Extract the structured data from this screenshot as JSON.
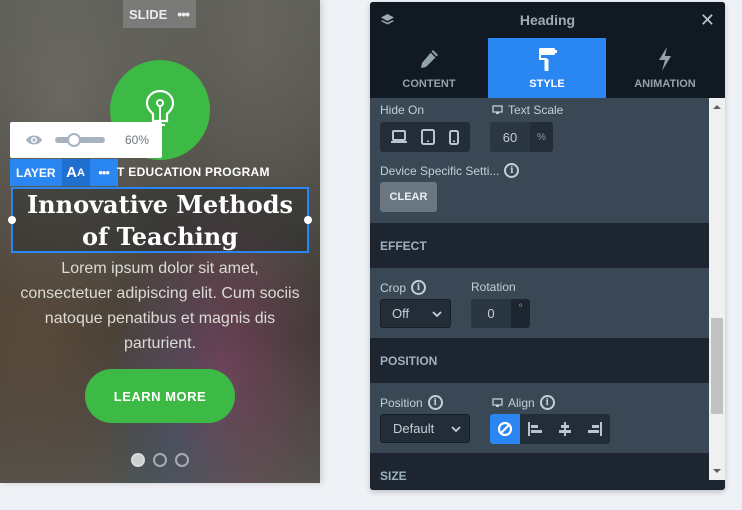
{
  "preview": {
    "slide_tag": "SLIDE",
    "slide_more": "•••",
    "opacity_value": "60%",
    "opacity_fraction": 0.6,
    "layer_label": "LAYER",
    "layer_font_icon_big": "A",
    "layer_font_icon_small": "A",
    "layer_more": "•••",
    "subtitle": "T EDUCATION PROGRAM",
    "heading": "Innovative Methods of Teaching",
    "body": "Lorem ipsum dolor sit amet, consectetuer adipiscing elit. Cum sociis natoque penatibus et magnis dis parturient.",
    "cta": "LEARN MORE",
    "slide_count": 3,
    "active_slide": 1,
    "colors": {
      "accent_green": "#3dba45",
      "selection_blue": "#2a86f0"
    }
  },
  "panel": {
    "title": "Heading",
    "close": "✕",
    "tabs": [
      {
        "label": "CONTENT",
        "icon": "pencil-icon",
        "active": false
      },
      {
        "label": "STYLE",
        "icon": "paint-roller-icon",
        "active": true
      },
      {
        "label": "ANIMATION",
        "icon": "lightning-icon",
        "active": false
      }
    ],
    "hide_on": {
      "label": "Hide On",
      "options": [
        "desktop-icon",
        "tablet-icon",
        "mobile-icon"
      ]
    },
    "text_scale": {
      "label": "Text Scale",
      "value": "60",
      "unit": "%"
    },
    "device_specific": {
      "label": "Device Specific Setti...",
      "button": "CLEAR"
    },
    "effect": {
      "heading": "EFFECT",
      "crop": {
        "label": "Crop",
        "value": "Off"
      },
      "rotation": {
        "label": "Rotation",
        "value": "0",
        "unit": "°"
      }
    },
    "position": {
      "heading": "POSITION",
      "position_field": {
        "label": "Position",
        "value": "Default"
      },
      "align": {
        "label": "Align",
        "options": [
          "none-icon",
          "align-left-icon",
          "align-center-icon",
          "align-right-icon"
        ],
        "active": 0
      }
    },
    "size": {
      "heading": "SIZE"
    },
    "colors": {
      "active_tab": "#2a86f0",
      "panel_bg": "#1d2630",
      "section_bg": "#3a4855"
    }
  }
}
